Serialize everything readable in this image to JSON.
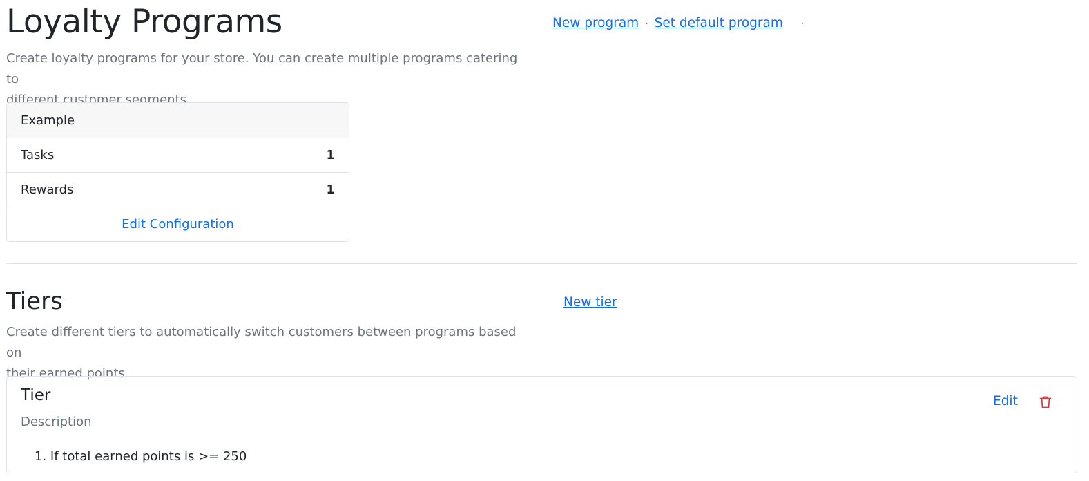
{
  "programs": {
    "title": "Loyalty Programs",
    "description_line1": "Create loyalty programs for your store. You can create multiple programs catering to",
    "description_line2": "different customer segments",
    "new_program_link": "New program",
    "separator": "·",
    "set_default_link": "Set default program",
    "trailing_separator": "·"
  },
  "program_card": {
    "name": "Example",
    "rows": [
      {
        "label": "Tasks",
        "value": "1"
      },
      {
        "label": "Rewards",
        "value": "1"
      }
    ],
    "edit_link": "Edit Configuration"
  },
  "tiers": {
    "title": "Tiers",
    "new_tier_link": "New tier",
    "description_line1": "Create different tiers to automatically switch customers between programs based on",
    "description_line2": "their earned points",
    "items": [
      {
        "name": "Tier",
        "description": "Description",
        "condition": "1. If total earned points is >= 250",
        "edit_link": "Edit",
        "delete_icon": "trash-icon"
      }
    ]
  },
  "colors": {
    "link": "#0d6efd",
    "muted": "#6c757d",
    "danger": "#dc3545",
    "border": "#dee2e6",
    "card_header_bg": "#f7f7f7"
  }
}
